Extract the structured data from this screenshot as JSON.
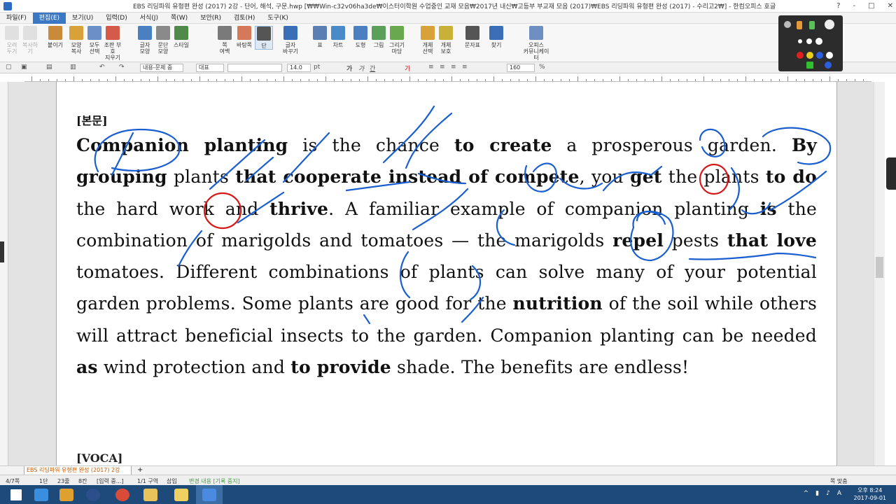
{
  "window": {
    "title": "EBS 리딩파워 유형편 완성 (2017) 2강 - 단어, 해석, 구문.hwp [₩₩Win-c32v06ha3de₩이스터이학원 수업중인 교재 모음₩2017년 내신₩고등부 부교재 모음 (2017)₩EBS 리딩파워 유형편 완성 (2017) - 수리고2₩] - 한컴오피스 호글",
    "buttons": [
      "?",
      "-",
      "□",
      "✕"
    ]
  },
  "menu": [
    {
      "label": "파일(F)",
      "active": false
    },
    {
      "label": "편집(E)",
      "active": true
    },
    {
      "label": "보기(U)",
      "active": false
    },
    {
      "label": "입력(D)",
      "active": false
    },
    {
      "label": "서식(J)",
      "active": false
    },
    {
      "label": "쪽(W)",
      "active": false
    },
    {
      "label": "보안(R)",
      "active": false
    },
    {
      "label": "검토(H)",
      "active": false
    },
    {
      "label": "도구(K)",
      "active": false
    }
  ],
  "ribbon": [
    {
      "label": "오려\n두기",
      "color": "#c8c8c8",
      "disabled": true
    },
    {
      "label": "복사하기",
      "color": "#c8c8c8",
      "disabled": true
    },
    {
      "label": "붙이기",
      "color": "#c98b3b",
      "disabled": false
    },
    {
      "label": "모양\n복사",
      "color": "#d8a13a",
      "disabled": false
    },
    {
      "label": "모두\n선택",
      "color": "#6b8fc7",
      "disabled": false
    },
    {
      "label": "조판 부호\n지우기",
      "color": "#d45a4a",
      "disabled": false
    },
    {
      "label": "글자\n모양",
      "color": "#4a7fc1",
      "disabled": false
    },
    {
      "label": "문단\n모양",
      "color": "#8a8a8a",
      "disabled": false
    },
    {
      "label": "스타일",
      "color": "#4f8a4a",
      "disabled": false
    },
    {
      "label": "쪽\n여백",
      "color": "#7a7a7a",
      "disabled": false
    },
    {
      "label": "바탕쪽",
      "color": "#d47a5a",
      "disabled": false
    },
    {
      "label": "단",
      "color": "#555555",
      "disabled": false
    },
    {
      "label": "글자\n바꾸기",
      "color": "#3a6fb7",
      "disabled": false
    },
    {
      "label": "표",
      "color": "#5b7fb4",
      "disabled": false
    },
    {
      "label": "차트",
      "color": "#4a8ac9",
      "disabled": false
    },
    {
      "label": "도형",
      "color": "#4a7fc1",
      "disabled": false
    },
    {
      "label": "그림",
      "color": "#5aa05a",
      "disabled": false
    },
    {
      "label": "그리기마당",
      "color": "#6aa84f",
      "disabled": false
    },
    {
      "label": "개체\n선택",
      "color": "#d8a13a",
      "disabled": false
    },
    {
      "label": "개체\n보호",
      "color": "#c9b037",
      "disabled": false
    },
    {
      "label": "문자표",
      "color": "#555555",
      "disabled": false
    },
    {
      "label": "찾기",
      "color": "#3a6fb7",
      "disabled": false
    },
    {
      "label": "오피스\n커뮤니케이터",
      "color": "#6d8fc2",
      "disabled": false
    }
  ],
  "toolbar2": {
    "style_name": "내용-문제 중",
    "font_lang": "대표",
    "font_name": "",
    "font_size": "14.0",
    "font_unit": "pt",
    "zoom": "160",
    "zoom_unit": "%"
  },
  "document": {
    "heading": "[본문]",
    "paragraph": [
      {
        "t": "Companion planting",
        "b": true
      },
      {
        "t": " is the chance ",
        "b": false
      },
      {
        "t": "to create",
        "b": true
      },
      {
        "t": " a prosperous garden. ",
        "b": false
      },
      {
        "t": "By grouping",
        "b": true
      },
      {
        "t": " plants ",
        "b": false
      },
      {
        "t": "that cooperate instead of compete",
        "b": true
      },
      {
        "t": ", you ",
        "b": false
      },
      {
        "t": "get",
        "b": true
      },
      {
        "t": " the plants ",
        "b": false
      },
      {
        "t": "to do",
        "b": true
      },
      {
        "t": " the hard work and ",
        "b": false
      },
      {
        "t": "thrive",
        "b": true
      },
      {
        "t": ". A familiar example of companion planting ",
        "b": false
      },
      {
        "t": "is",
        "b": true
      },
      {
        "t": " the combination of marigolds and tomatoes — the marigolds ",
        "b": false
      },
      {
        "t": "repel",
        "b": true
      },
      {
        "t": " pests ",
        "b": false
      },
      {
        "t": "that love",
        "b": true
      },
      {
        "t": " tomatoes. Different combinations of plants can solve many of your potential garden problems. Some plants are good for the ",
        "b": false
      },
      {
        "t": "nutrition",
        "b": true
      },
      {
        "t": " of the soil while others will attract beneficial insects to the garden. Companion planting can be needed ",
        "b": false
      },
      {
        "t": "as",
        "b": true
      },
      {
        "t": " wind protection and ",
        "b": false
      },
      {
        "t": "to provide",
        "b": true
      },
      {
        "t": " shade. The benefits are endless!",
        "b": false
      }
    ],
    "section2": "[VOCA]"
  },
  "doc_tab": "EBS 리딩파워 유형편 완성 (2017) 2강",
  "add_tab": "+",
  "status": {
    "page": "4/7쪽",
    "column": "1단",
    "line": "23줄",
    "col": "8칸",
    "input": "[입력 중...]",
    "section": "1/1 구역",
    "mode": "삽입",
    "track": "변경 내용 [기록 중지]",
    "view": "쪽 맞춤"
  },
  "taskbar": {
    "apps": [
      {
        "name": "start",
        "color": "#ffffff"
      },
      {
        "name": "ie",
        "color": "#3a8ee0"
      },
      {
        "name": "store",
        "color": "#e0a030"
      },
      {
        "name": "help",
        "color": "#2b4f8a"
      },
      {
        "name": "chrome",
        "color": "#d94a38"
      },
      {
        "name": "explorer",
        "color": "#e8c25a"
      },
      {
        "name": "notes",
        "color": "#f0d060"
      },
      {
        "name": "hwp",
        "color": "#4a8ae0"
      }
    ],
    "time": "오후 8:24",
    "date": "2017-09-01",
    "ime": "A"
  },
  "colors": {
    "ink_blue": "#1a5fd0",
    "ink_red": "#d81818",
    "menu_active": "#3b78c4",
    "taskbar": "#1d4a79"
  }
}
